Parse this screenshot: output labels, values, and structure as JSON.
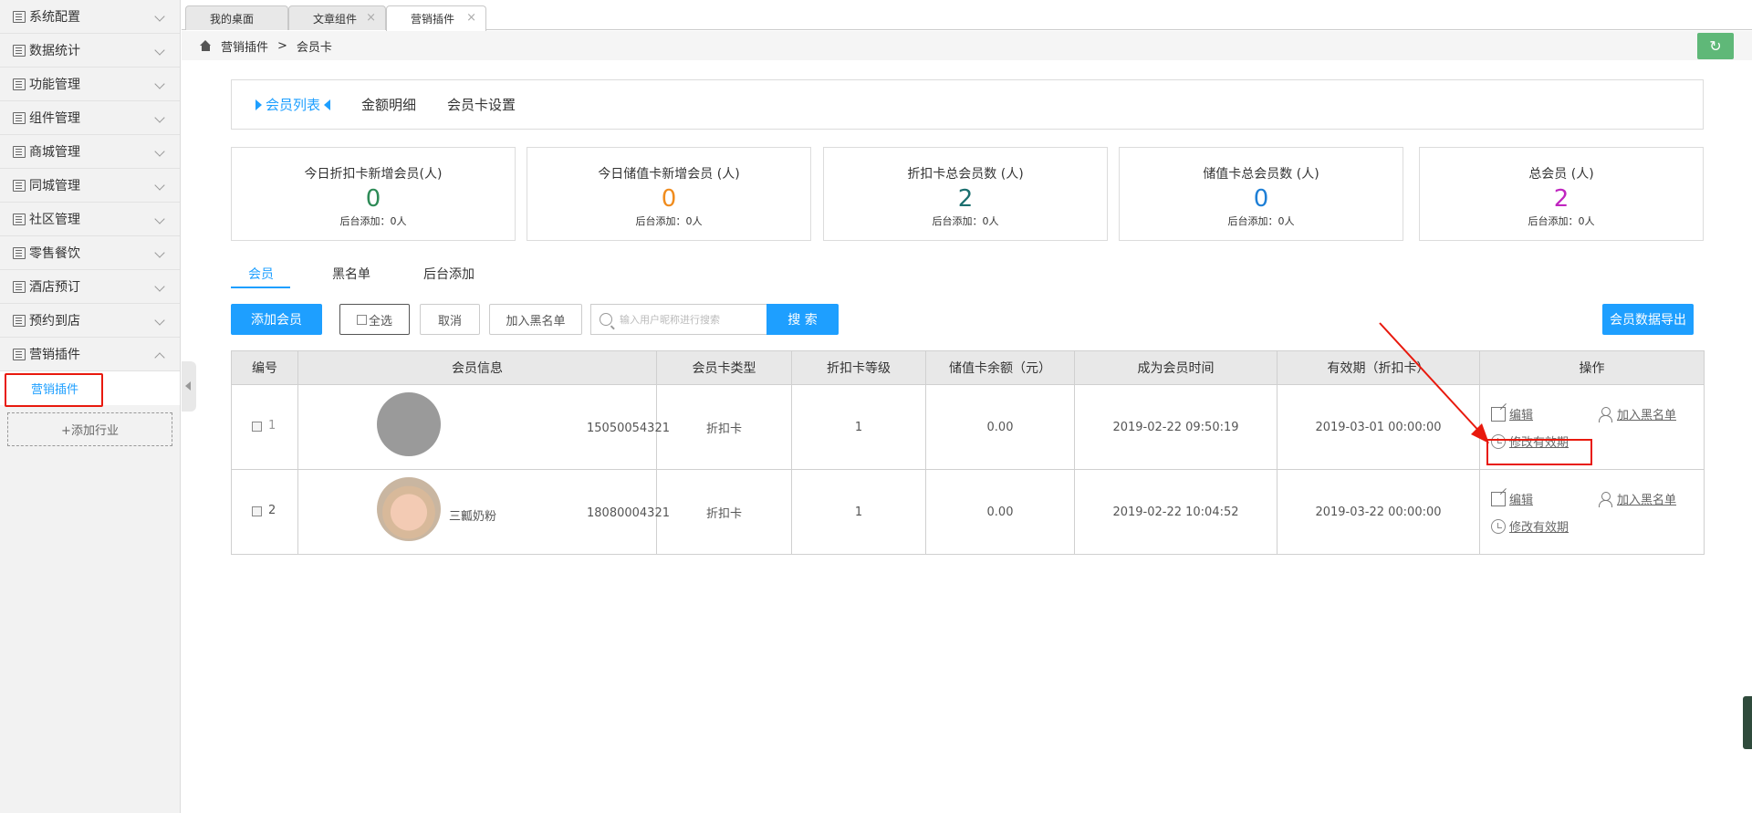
{
  "sidebar": {
    "items": [
      {
        "label": "系统配置"
      },
      {
        "label": "数据统计"
      },
      {
        "label": "功能管理"
      },
      {
        "label": "组件管理"
      },
      {
        "label": "商城管理"
      },
      {
        "label": "同城管理"
      },
      {
        "label": "社区管理"
      },
      {
        "label": "零售餐饮"
      },
      {
        "label": "酒店预订"
      },
      {
        "label": "预约到店"
      },
      {
        "label": "营销插件"
      }
    ],
    "active_sub": "营销插件",
    "add_industry": "+添加行业"
  },
  "tabs": [
    {
      "label": "我的桌面"
    },
    {
      "label": "文章组件"
    },
    {
      "label": "营销插件"
    }
  ],
  "breadcrumb": {
    "parent": "营销插件",
    "separator": ">",
    "current": "会员卡"
  },
  "main_tabs": [
    {
      "label": "会员列表"
    },
    {
      "label": "金额明细"
    },
    {
      "label": "会员卡设置"
    }
  ],
  "stats": [
    {
      "title": "今日折扣卡新增会员(人)",
      "value": "0",
      "sub": "后台添加：0人",
      "color": "#2e8b57"
    },
    {
      "title": "今日储值卡新增会员 (人)",
      "value": "0",
      "sub": "后台添加：0人",
      "color": "#f08c1e"
    },
    {
      "title": "折扣卡总会员数 (人)",
      "value": "2",
      "sub": "后台添加：0人",
      "color": "#1b6f6f"
    },
    {
      "title": "储值卡总会员数 (人)",
      "value": "0",
      "sub": "后台添加：0人",
      "color": "#1e7fd6"
    },
    {
      "title": "总会员 (人)",
      "value": "2",
      "sub": "后台添加：0人",
      "color": "#c026c0"
    }
  ],
  "sub_tabs": [
    {
      "label": "会员"
    },
    {
      "label": "黑名单"
    },
    {
      "label": "后台添加"
    }
  ],
  "toolbar": {
    "add_member": "添加会员",
    "select_all": "全选",
    "cancel": "取消",
    "add_blacklist": "加入黑名单",
    "search_placeholder": "输入用户昵称进行搜索",
    "search": "搜 索",
    "export": "会员数据导出"
  },
  "table": {
    "headers": [
      "编号",
      "会员信息",
      "会员卡类型",
      "折扣卡等级",
      "储值卡余额（元）",
      "成为会员时间",
      "有效期（折扣卡）",
      "操作"
    ],
    "rows": [
      {
        "no": "1",
        "name": "",
        "phone": "15050054321",
        "card_type": "折扣卡",
        "level": "1",
        "balance": "0.00",
        "joined": "2019-02-22 09:50:19",
        "expiry": "2019-03-01 00:00:00"
      },
      {
        "no": "2",
        "name": "三瓤奶粉",
        "phone": "18080004321",
        "card_type": "折扣卡",
        "level": "1",
        "balance": "0.00",
        "joined": "2019-02-22 10:04:52",
        "expiry": "2019-03-22 00:00:00"
      }
    ],
    "ops": {
      "edit": "编辑",
      "blacklist": "加入黑名单",
      "modify_expiry": "修改有效期"
    }
  }
}
